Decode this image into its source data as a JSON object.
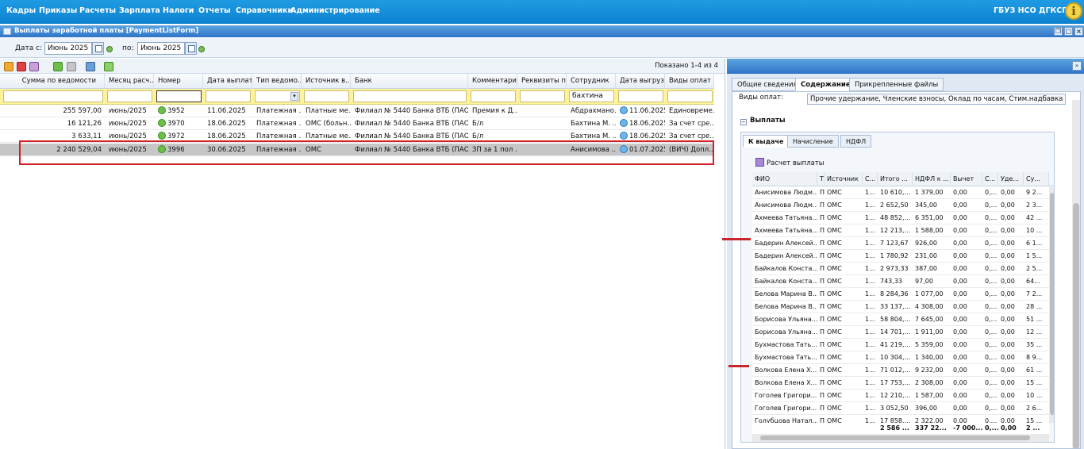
{
  "menu": [
    "Кадры",
    "Приказы",
    "Расчеты",
    "Зарплата",
    "Налоги",
    "Отчеты",
    "Справочники",
    "Администрирование"
  ],
  "org": "ГБУЗ НСО ДГКСП",
  "info_glyph": "i",
  "window": {
    "title": "Выплаты заработной платы [PaymentListForm]"
  },
  "dates": {
    "from_label": "Дата с:",
    "from_value": "Июнь 2025",
    "to_label": "по:",
    "to_value": "Июнь 2025"
  },
  "toolbar": {
    "icons": [
      "edit-icon",
      "delete-icon",
      "settings-icon",
      "approve-icon",
      "disapprove-icon",
      "print-icon",
      "refresh-icon"
    ],
    "shown": "Показано 1-4 из 4"
  },
  "grid": {
    "headers": [
      "Сумма по ведомости",
      "Месяц расч...",
      "Номер",
      "Дата выплаты",
      "Тип ведомо...",
      "Источник в...",
      "Банк",
      "Комментарий",
      "Реквизиты п...",
      "Сотрудник",
      "Дата выгруз...",
      "Виды оплат"
    ],
    "filter_employee": "бахтина",
    "rows": [
      [
        "255 597,00",
        "июнь/2025",
        "3952",
        "11.06.2025",
        "Платежная ...",
        "Платные ме...",
        "Филиал № 5440 Банка ВТБ (ПАО)",
        "Премия к Д...",
        "",
        "Абдрахмано...",
        "11.06.2025",
        "Единовреме..."
      ],
      [
        "16 121,26",
        "июнь/2025",
        "3970",
        "18.06.2025",
        "Платежная ...",
        "ОМС (больн...",
        "Филиал № 5440 Банка ВТБ (ПАО)",
        "Б/л",
        "",
        "Бахтина М. ...",
        "18.06.2025",
        "За счет сре..."
      ],
      [
        "3 633,11",
        "июнь/2025",
        "3972",
        "18.06.2025",
        "Платежная ...",
        "Платные ме...",
        "Филиал № 5440 Банка ВТБ (ПАО)",
        "Б/л",
        "",
        "Бахтина М. ...",
        "18.06.2025",
        "За счет сре..."
      ],
      [
        "2 240 529,04",
        "июнь/2025",
        "3996",
        "30.06.2025",
        "Платежная ...",
        "ОМС",
        "Филиал № 5440 Банка ВТБ (ПАО)",
        "ЗП за 1 пол ...",
        "",
        "Анисимова ...",
        "01.07.2025",
        "(ВИЧ) Допл..."
      ]
    ]
  },
  "right": {
    "collapse_glyph": "»",
    "tabs": [
      "Общие сведения",
      "Содержание",
      "Прикрепленные файлы"
    ],
    "vidy_label": "Виды оплат:",
    "vidy_value": "Прочие удержание, Членские взносы, Оклад по часам, Стим.надбавка за ста",
    "section_title": "Выплаты",
    "section_toggle": "−",
    "inner_tabs": [
      "К выдаче",
      "Начисление",
      "НДФЛ"
    ],
    "calc_label": "Расчет выплаты",
    "sub_headers": [
      "ФИО",
      "Т",
      "Источник",
      "С...",
      "Итого ...",
      "НДФЛ к ...",
      "Вычет",
      "С...",
      "Уде...",
      "Су..."
    ],
    "sub_rows": [
      [
        "Анисимова Людм...",
        "П",
        "ОМС",
        "1...",
        "10 610,...",
        "1 379,00",
        "0,00",
        "0,...",
        "0,00",
        "9 2..."
      ],
      [
        "Анисимова Людм...",
        "П",
        "ОМС",
        "1...",
        "2 652,50",
        "345,00",
        "0,00",
        "0,...",
        "0,00",
        "2 3..."
      ],
      [
        "Ахмеева Татьяна...",
        "П",
        "ОМС",
        "1...",
        "48 852,...",
        "6 351,00",
        "0,00",
        "0,...",
        "0,00",
        "42 ..."
      ],
      [
        "Ахмеева Татьяна...",
        "П",
        "ОМС",
        "1...",
        "12 213,...",
        "1 588,00",
        "0,00",
        "0,...",
        "0,00",
        "10 ..."
      ],
      [
        "Бадерин Алексей...",
        "П",
        "ОМС",
        "1...",
        "7 123,67",
        "926,00",
        "0,00",
        "0,...",
        "0,00",
        "6 1..."
      ],
      [
        "Бадерин Алексей...",
        "П",
        "ОМС",
        "1...",
        "1 780,92",
        "231,00",
        "0,00",
        "0,...",
        "0,00",
        "1 5..."
      ],
      [
        "Байкалов Конста...",
        "П",
        "ОМС",
        "1...",
        "2 973,33",
        "387,00",
        "0,00",
        "0,...",
        "0,00",
        "2 5..."
      ],
      [
        "Байкалов Конста...",
        "П",
        "ОМС",
        "1...",
        "743,33",
        "97,00",
        "0,00",
        "0,...",
        "0,00",
        "64..."
      ],
      [
        "Белова Марина В...",
        "П",
        "ОМС",
        "1...",
        "8 284,36",
        "1 077,00",
        "0,00",
        "0,...",
        "0,00",
        "7 2..."
      ],
      [
        "Белова Марина В...",
        "П",
        "ОМС",
        "1...",
        "33 137,...",
        "4 308,00",
        "0,00",
        "0,...",
        "0,00",
        "28 ..."
      ],
      [
        "Борисова Ульяна...",
        "П",
        "ОМС",
        "1...",
        "58 804,...",
        "7 645,00",
        "0,00",
        "0,...",
        "0,00",
        "51 ..."
      ],
      [
        "Борисова Ульяна...",
        "П",
        "ОМС",
        "1...",
        "14 701,...",
        "1 911,00",
        "0,00",
        "0,...",
        "0,00",
        "12 ..."
      ],
      [
        "Бухмастова Тать...",
        "П",
        "ОМС",
        "1...",
        "41 219,...",
        "5 359,00",
        "0,00",
        "0,...",
        "0,00",
        "35 ..."
      ],
      [
        "Бухмастова Тать...",
        "П",
        "ОМС",
        "1...",
        "10 304,...",
        "1 340,00",
        "0,00",
        "0,...",
        "0,00",
        "8 9..."
      ],
      [
        "Волкова Елена Х...",
        "П",
        "ОМС",
        "1...",
        "71 012,...",
        "9 232,00",
        "0,00",
        "0,...",
        "0,00",
        "61 ..."
      ],
      [
        "Волкова Елена Х...",
        "П",
        "ОМС",
        "1...",
        "17 753,...",
        "2 308,00",
        "0,00",
        "0,...",
        "0,00",
        "15 ..."
      ],
      [
        "Гоголев Григори...",
        "П",
        "ОМС",
        "1...",
        "12 210,...",
        "1 587,00",
        "0,00",
        "0,...",
        "0,00",
        "10 ..."
      ],
      [
        "Гоголев Григори...",
        "П",
        "ОМС",
        "1...",
        "3 052,50",
        "396,00",
        "0,00",
        "0,...",
        "0,00",
        "2 6..."
      ],
      [
        "Голубцова Натал...",
        "П",
        "ОМС",
        "1...",
        "17 858,...",
        "2 322,00",
        "0,00",
        "0,...",
        "0,00",
        "15 ..."
      ]
    ],
    "sub_totals": [
      "2 586 ...",
      "337 22...",
      "-7 000...",
      "0,...",
      "0,00",
      "2 ..."
    ]
  }
}
